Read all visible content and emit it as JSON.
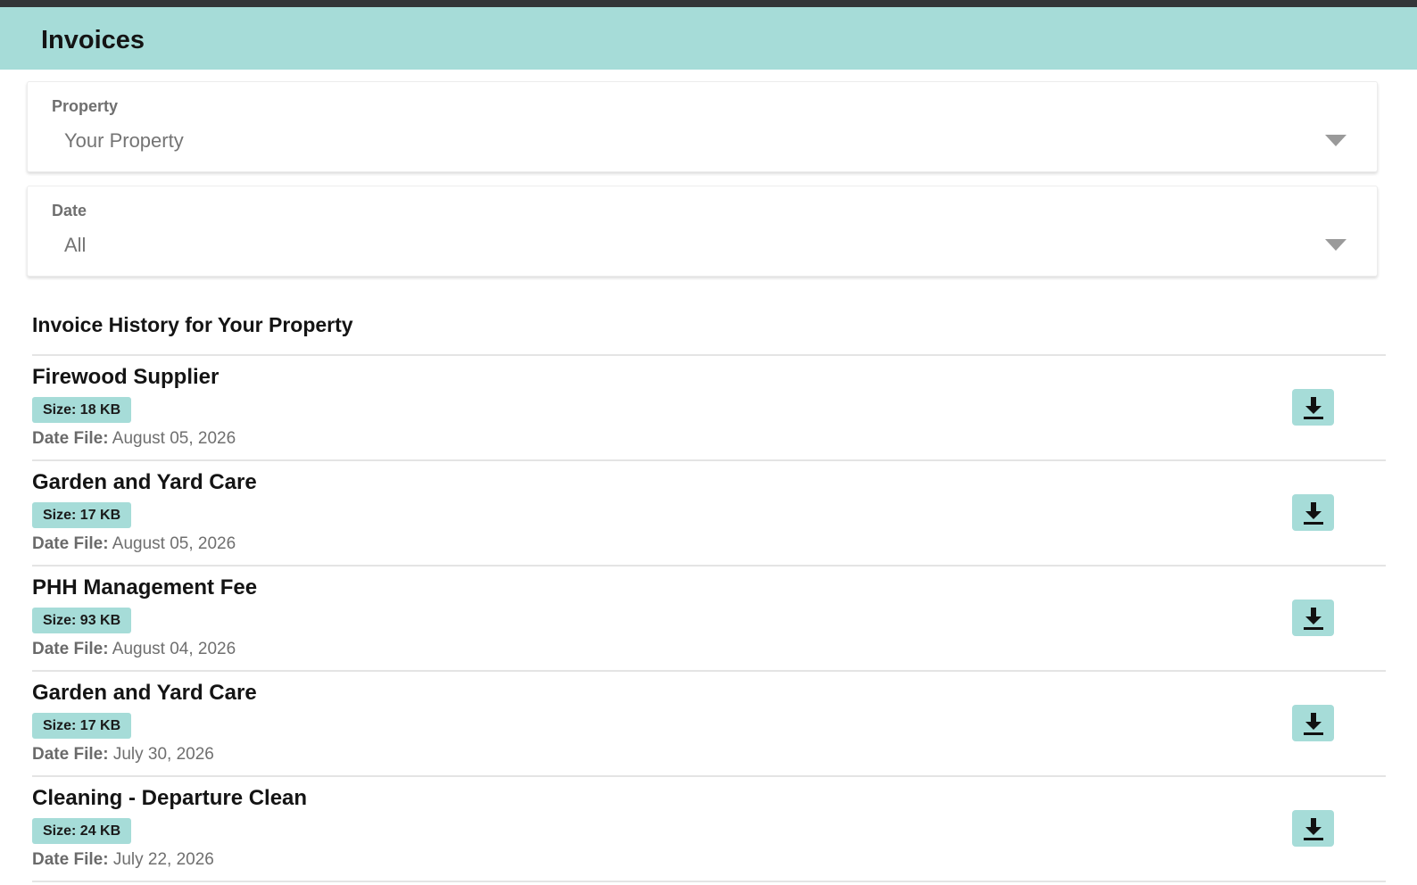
{
  "header": {
    "title": "Invoices"
  },
  "filters": {
    "property": {
      "label": "Property",
      "value": "Your Property"
    },
    "date": {
      "label": "Date",
      "value": "All"
    }
  },
  "section_title": "Invoice History for Your Property",
  "date_file_label": "Date File:",
  "invoices": [
    {
      "title": "Firewood Supplier",
      "size": "Size: 18 KB",
      "date": "August 05, 2026"
    },
    {
      "title": "Garden and Yard Care",
      "size": "Size: 17 KB",
      "date": "August 05, 2026"
    },
    {
      "title": "PHH Management Fee",
      "size": "Size: 93 KB",
      "date": "August 04, 2026"
    },
    {
      "title": "Garden and Yard Care",
      "size": "Size: 17 KB",
      "date": "July 30, 2026"
    },
    {
      "title": "Cleaning - Departure Clean",
      "size": "Size: 24 KB",
      "date": "July 22, 2026"
    }
  ],
  "icons": {
    "download": "download-icon",
    "dropdown": "chevron-down-icon"
  },
  "colors": {
    "accent": "#a6dcd8",
    "top_strip": "#333638"
  }
}
